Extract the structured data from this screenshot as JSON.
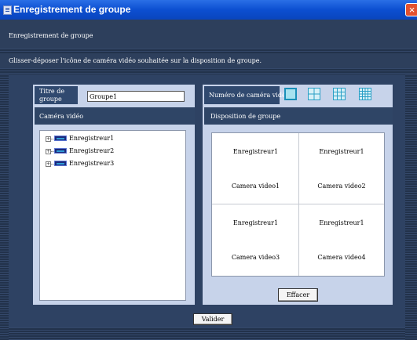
{
  "window": {
    "title": "Enregistrement de groupe",
    "close_glyph": "×"
  },
  "header": {
    "title": "Enregistrement de groupe"
  },
  "instruction": "Glisser-déposer l'icône de caméra vidéo souhaitée sur la disposition de groupe.",
  "group_title": {
    "label": "Titre de groupe",
    "value": "Groupe1"
  },
  "camera_panel": {
    "title": "Caméra vidéo",
    "recorders": [
      "Enregistreur1",
      "Enregistreur2",
      "Enregistreur3"
    ],
    "expand_glyph": "+"
  },
  "camera_number": {
    "label": "Numéro de caméra vidéo",
    "options": [
      "1",
      "4",
      "9",
      "16"
    ],
    "selected": "1"
  },
  "layout_panel": {
    "title": "Disposition de groupe",
    "cells": [
      {
        "recorder": "Enregistreur1",
        "camera": "Camera video1"
      },
      {
        "recorder": "Enregistreur1",
        "camera": "Camera video2"
      },
      {
        "recorder": "Enregistreur1",
        "camera": "Camera video3"
      },
      {
        "recorder": "Enregistreur1",
        "camera": "Camera video4"
      }
    ]
  },
  "buttons": {
    "clear": "Effacer",
    "submit": "Valider"
  }
}
